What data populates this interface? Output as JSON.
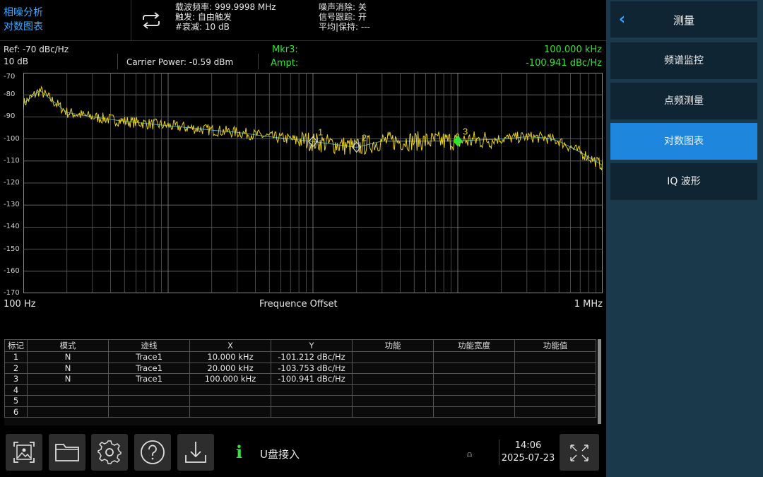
{
  "header": {
    "mode_line1": "相噪分析",
    "mode_line2": "对数图表",
    "mode_toggle_icon": "repeat-arrows-icon",
    "carrier_freq": "载波频率: 999.9998 MHz",
    "trigger": "触发: 自由触发",
    "attenuation": "#衰减: 10 dB",
    "noise_cancel": "噪声消除: 关",
    "signal_track": "信号跟踪: 开",
    "avg_hold": "平均|保持: ---"
  },
  "measurement": {
    "ref": "Ref: -70 dBc/Hz",
    "scale": "10 dB",
    "carrier_power": "Carrier Power: -0.59 dBm",
    "marker_name": "Mkr3:",
    "marker_ampt_label": "Ampt:",
    "marker_freq": "100.000 kHz",
    "marker_ampt": "-100.941 dBc/Hz"
  },
  "chart_data": {
    "type": "line",
    "title": "",
    "xlabel": "Frequence Offset",
    "ylabel": "",
    "x_scale": "log",
    "x_start_label": "100 Hz",
    "x_stop_label": "1 MHz",
    "xlim_hz": [
      100,
      1000000
    ],
    "ylim": [
      -170,
      -70
    ],
    "y_ticks": [
      "-70",
      "-80",
      "-90",
      "-100",
      "-110",
      "-120",
      "-130",
      "-140",
      "-150",
      "-160",
      "-170"
    ],
    "grid": true,
    "trace_color": "#e8d21c",
    "smooth_color": "#4aa0c0",
    "series": [
      {
        "x": [
          100,
          130,
          200,
          300,
          500,
          1000,
          2000,
          3000,
          5000,
          10000,
          20000,
          30000,
          50000,
          100000,
          200000,
          300000,
          400000,
          500000,
          700000,
          1000000
        ],
        "y": [
          -84,
          -78,
          -88,
          -90,
          -92,
          -94,
          -96,
          -97,
          -99,
          -101.2,
          -103.8,
          -101,
          -101,
          -100.9,
          -100,
          -99,
          -99.5,
          -101,
          -106,
          -112
        ]
      }
    ],
    "markers": [
      {
        "label": "1",
        "x": 10000,
        "y": -101.212,
        "active": false
      },
      {
        "label": "2",
        "x": 20000,
        "y": -103.753,
        "active": false
      },
      {
        "label": "3",
        "x": 100000,
        "y": -100.941,
        "active": true
      }
    ]
  },
  "table": {
    "headers": [
      "标记",
      "模式",
      "迹线",
      "X",
      "Y",
      "功能",
      "功能宽度",
      "功能值"
    ],
    "rows": [
      [
        "1",
        "N",
        "Trace1",
        "10.000 kHz",
        "-101.212 dBc/Hz",
        "",
        "",
        ""
      ],
      [
        "2",
        "N",
        "Trace1",
        "20.000 kHz",
        "-103.753 dBc/Hz",
        "",
        "",
        ""
      ],
      [
        "3",
        "N",
        "Trace1",
        "100.000 kHz",
        "-100.941 dBc/Hz",
        "",
        "",
        ""
      ],
      [
        "4",
        "",
        "",
        "",
        "",
        "",
        "",
        ""
      ],
      [
        "5",
        "",
        "",
        "",
        "",
        "",
        "",
        ""
      ],
      [
        "6",
        "",
        "",
        "",
        "",
        "",
        "",
        ""
      ]
    ]
  },
  "toolbar": {
    "icons": [
      "screenshot-icon",
      "folder-icon",
      "settings-gear-icon",
      "help-icon",
      "download-icon"
    ],
    "status_icon": "i",
    "status_message": "U盘接入",
    "usb_icon": "⩍",
    "time": "14:06",
    "date": "2025-07-23",
    "fullscreen_icon": "fullscreen-arrows-icon"
  },
  "menu": {
    "title": "测量",
    "items": [
      {
        "label": "频谱监控",
        "active": false
      },
      {
        "label": "点频测量",
        "active": false
      },
      {
        "label": "对数图表",
        "active": true
      },
      {
        "label": "IQ 波形",
        "active": false
      }
    ]
  }
}
